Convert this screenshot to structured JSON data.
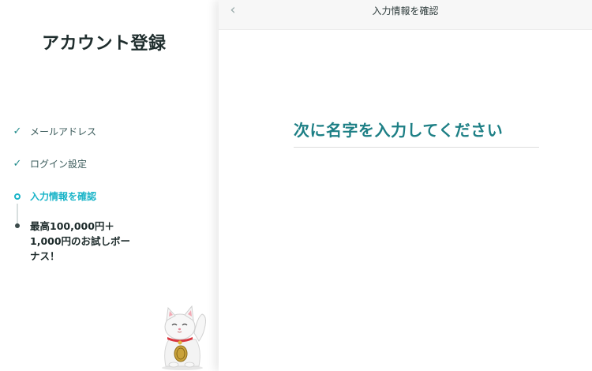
{
  "sidebar": {
    "title": "アカウント登録",
    "steps": [
      {
        "label": "メールアドレス",
        "status": "done"
      },
      {
        "label": "ログイン設定",
        "status": "done"
      },
      {
        "label": "入力情報を確認",
        "status": "current"
      },
      {
        "label": "最高100,000円＋1,000円のお試しボーナス！",
        "lines": [
          "最高100,000円＋",
          "1,000円のお試しボー",
          "ナス！"
        ],
        "status": "upcoming"
      }
    ],
    "mascot_icon": "maneki-neko-icon"
  },
  "header": {
    "back_icon": "chevron-left-icon",
    "title": "入力情報を確認"
  },
  "main": {
    "heading": "次に名字を入力してください"
  },
  "colors": {
    "accent": "#1d7f85",
    "current_step": "#19b4c8",
    "check": "#1f8a8a"
  }
}
